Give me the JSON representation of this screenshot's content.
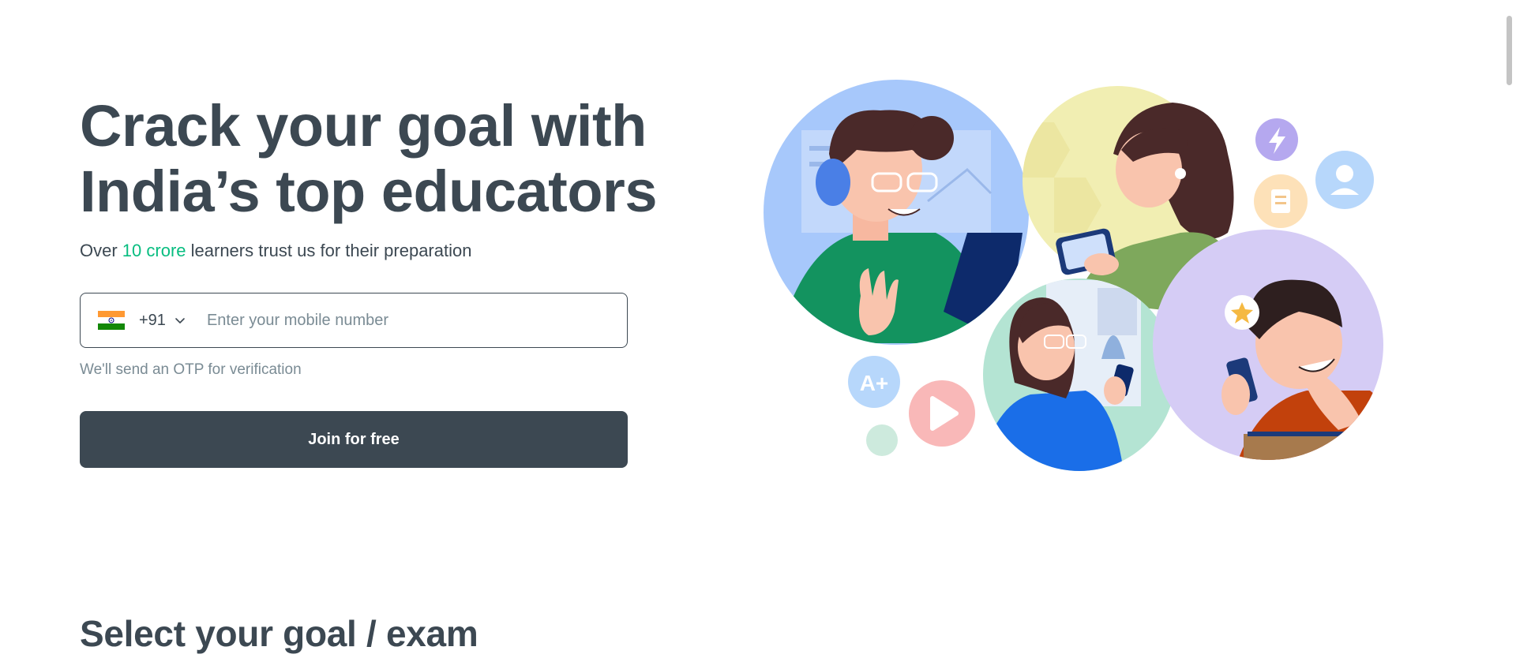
{
  "hero": {
    "title_line1": "Crack your goal with",
    "title_line2": "India’s top educators",
    "subtitle_pre": "Over ",
    "subtitle_highlight": "10 crore",
    "subtitle_post": " learners trust us for their preparation"
  },
  "phone": {
    "country_code": "+91",
    "placeholder": "Enter your mobile number",
    "value": ""
  },
  "otp_note": "We'll send an OTP for verification",
  "join_button": "Join for free",
  "section": {
    "title": "Select your goal / exam"
  },
  "colors": {
    "text": "#3c4852",
    "highlight": "#08bd80",
    "button_bg": "#3c4852",
    "muted": "#7a8b94"
  },
  "icons": {
    "flag": "india-flag-icon",
    "chevron": "chevron-down-icon"
  }
}
